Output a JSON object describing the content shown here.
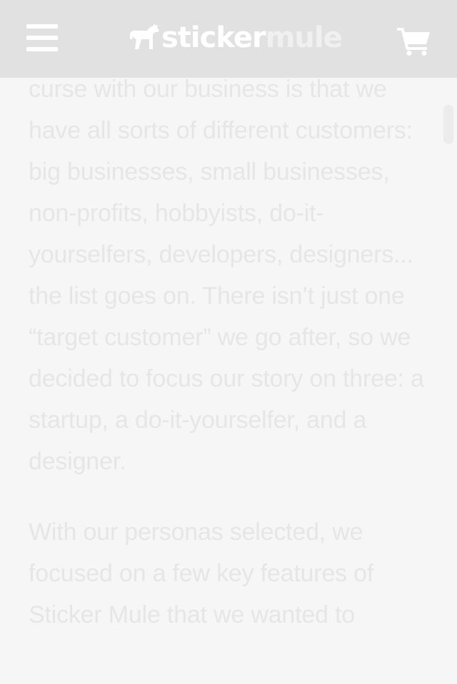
{
  "header": {
    "brand_part1": "sticker",
    "brand_part2": "mule",
    "menu_icon": "hamburger-menu-icon",
    "cart_icon": "shopping-cart-icon"
  },
  "article": {
    "paragraphs": [
      "curse with our business is that we have all sorts of different customers: big businesses, small businesses, non-profits, hobbyists, do-it-yourselfers, developers, designers... the list goes on. There isn’t just one “target customer” we go after, so we decided to focus our story on three: a startup, a do-it-yourselfer, and a designer.",
      "With our personas selected, we focused on a few key features of Sticker Mule that we wanted to"
    ]
  },
  "colors": {
    "header_bg": "#e1e1e1",
    "page_bg": "#f6f6f6",
    "text": "#e6e6e6",
    "icon": "#ffffff"
  }
}
